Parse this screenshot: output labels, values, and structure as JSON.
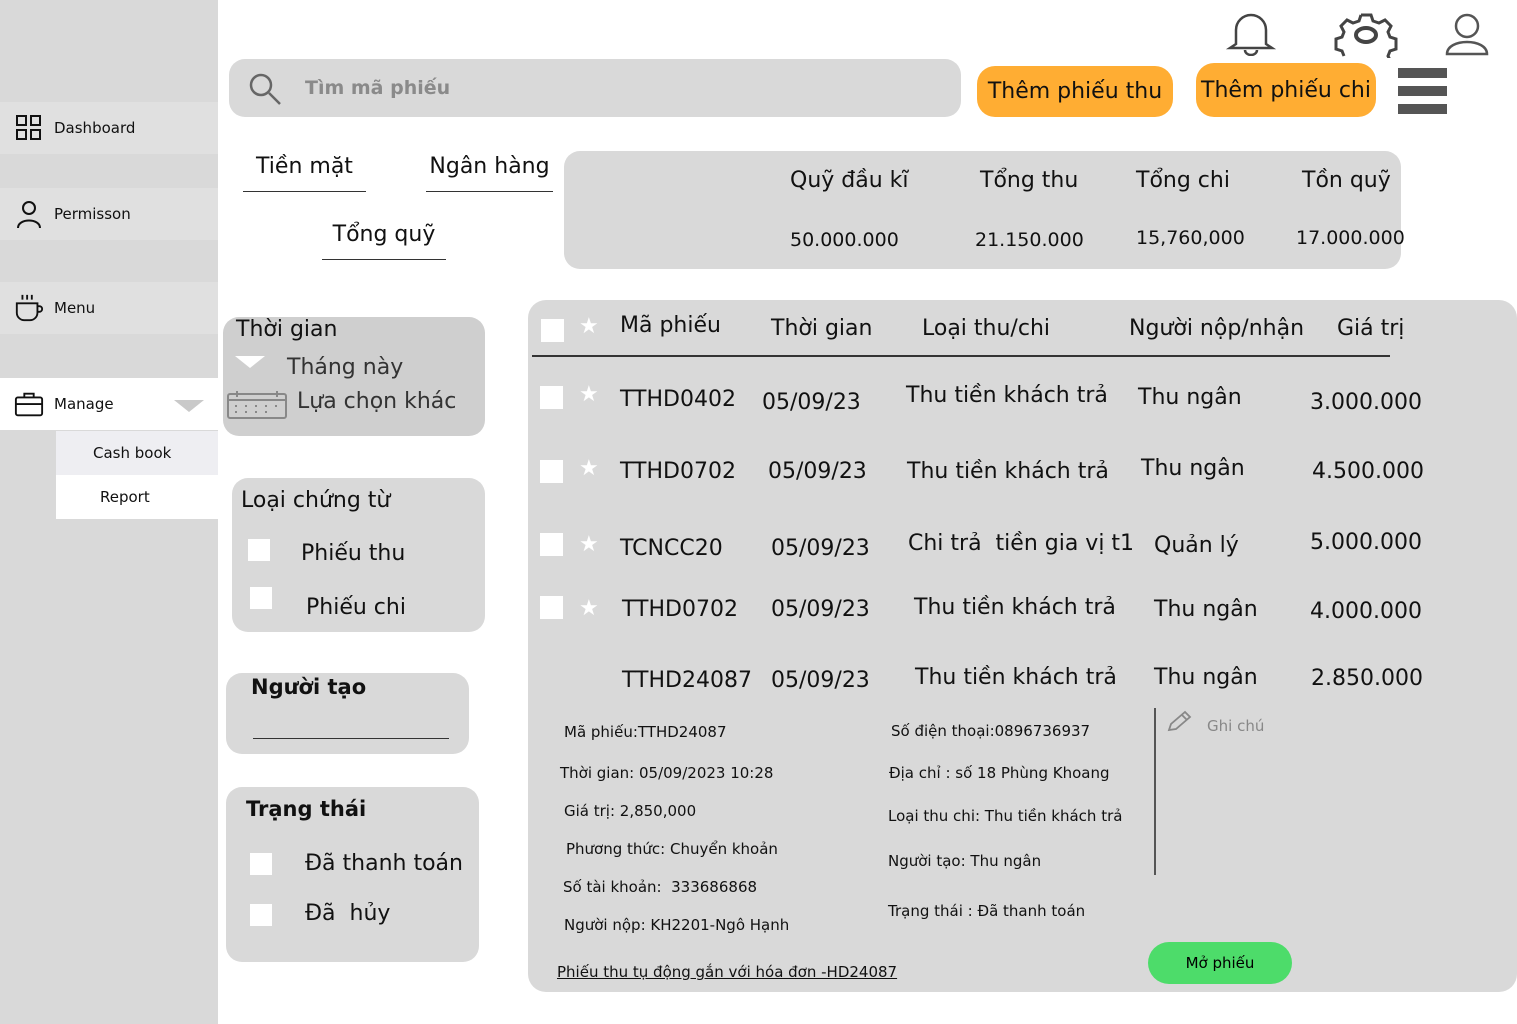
{
  "sidebar": {
    "items": [
      {
        "label": "Dashboard",
        "icon": "grid-icon"
      },
      {
        "label": "Permisson",
        "icon": "user-icon"
      },
      {
        "label": "Menu",
        "icon": "cup-icon"
      },
      {
        "label": "Manage",
        "icon": "briefcase-icon"
      }
    ],
    "sub_items": [
      {
        "label": "Cash book"
      },
      {
        "label": "Report"
      }
    ]
  },
  "header": {
    "search_placeholder": "Tìm mã phiếu",
    "add_receipt_label": "Thêm phiếu thu",
    "add_payment_label": "Thêm phiếu chi"
  },
  "tabs": {
    "cash": "Tiền mặt",
    "bank": "Ngân hàng",
    "total": "Tổng quỹ"
  },
  "summary": {
    "opening_label": "Quỹ đầu kĩ",
    "opening_value": "50.000.000",
    "income_label": "Tổng thu",
    "income_value": "21.150.000",
    "expense_label": "Tổng chi",
    "expense_value": "15,760,000",
    "balance_label": "Tồn quỹ",
    "balance_value": "17.000.000"
  },
  "filters": {
    "time": {
      "title": "Thời gian",
      "selected": "Tháng này",
      "custom": "Lựa chọn khác"
    },
    "doc_type": {
      "title": "Loại chứng từ",
      "options": [
        "Phiếu thu",
        "Phiếu chi"
      ]
    },
    "creator": {
      "title": "Người tạo"
    },
    "status": {
      "title": "Trạng thái",
      "options": [
        "Đã thanh toán",
        "Đã  hủy"
      ]
    }
  },
  "table": {
    "headers": [
      "Mã phiếu",
      "Thời gian",
      "Loại thu/chi",
      "Người nộp/nhận",
      "Giá trị"
    ],
    "rows": [
      {
        "code": "TTHD0402",
        "date": "05/09/23",
        "type": "Thu tiền khách trả",
        "person": "Thu ngân",
        "value": "3.000.000"
      },
      {
        "code": "TTHD0702",
        "date": "05/09/23",
        "type": "Thu tiền khách trả",
        "person": "Thu ngân",
        "value": "4.500.000"
      },
      {
        "code": "TCNCC20",
        "date": "05/09/23",
        "type": "Chi trả  tiền gia vị t1",
        "person": "Quản lý",
        "value": "5.000.000"
      },
      {
        "code": "TTHD0702",
        "date": "05/09/23",
        "type": "Thu tiền khách trả",
        "person": "Thu ngân",
        "value": "4.000.000"
      },
      {
        "code": "TTHD24087",
        "date": "05/09/23",
        "type": "Thu tiền khách trả",
        "person": "Thu ngân",
        "value": "2.850.000"
      }
    ]
  },
  "detail": {
    "code": "Mã phiếu:TTHD24087",
    "time": "Thời gian: 05/09/2023 10:28",
    "value": "Giá trị: 2,850,000",
    "method": "Phương thức: Chuyển khoản",
    "account": "Số tài khoản:  333686868",
    "payer": "Người nộp: KH2201-Ngô Hạnh",
    "phone": "Số điện thoại:0896736937",
    "address": "Địa chỉ : số 18 Phùng Khoang",
    "category": "Loại thu chi: Thu tiền khách trả",
    "creator": "Người tạo: Thu ngân",
    "status": "Trạng thái : Đã thanh toán",
    "note_placeholder": "Ghi chú",
    "link": "Phiếu thu tụ động gắn với hóa đơn -HD24087",
    "open_button": "Mở phiếu"
  },
  "colors": {
    "orange_button": "#ffad33",
    "green_button": "#4ddc6a",
    "panel_gray": "#d9d9d9"
  }
}
